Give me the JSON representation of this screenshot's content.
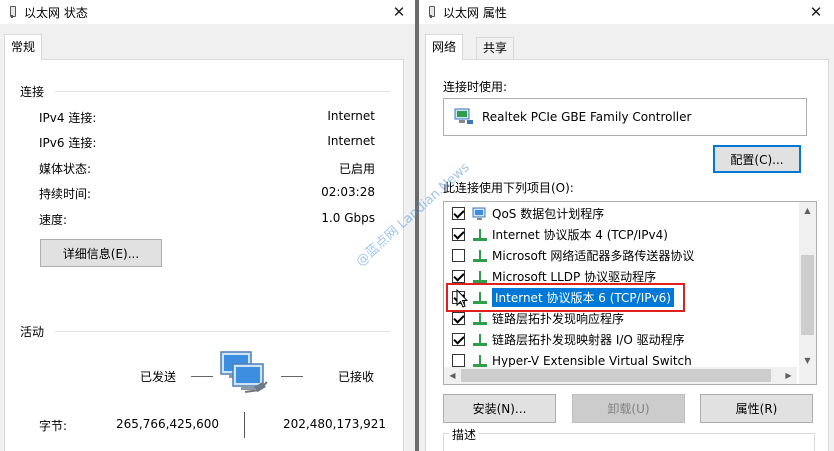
{
  "left_window": {
    "title": "以太网 状态",
    "tab": "常规",
    "connection": {
      "heading": "连接",
      "rows": [
        {
          "label": "IPv4 连接:",
          "value": "Internet"
        },
        {
          "label": "IPv6 连接:",
          "value": "Internet"
        },
        {
          "label": "媒体状态:",
          "value": "已启用"
        },
        {
          "label": "持续时间:",
          "value": "02:03:28"
        },
        {
          "label": "速度:",
          "value": "1.0 Gbps"
        }
      ],
      "details_button": "详细信息(E)..."
    },
    "activity": {
      "heading": "活动",
      "sent_label": "已发送",
      "received_label": "已接收",
      "bytes_label": "字节:",
      "bytes_sent": "265,766,425,600",
      "bytes_received": "202,480,173,921"
    }
  },
  "right_window": {
    "title": "以太网 属性",
    "tabs": [
      "网络",
      "共享"
    ],
    "connect_using_label": "连接时使用:",
    "adapter_name": "Realtek PCIe GBE Family Controller",
    "configure_button": "配置(C)...",
    "items_label": "此连接使用下列项目(O):",
    "items": [
      {
        "label": "QoS 数据包计划程序",
        "checked": true,
        "icon": "qos-network-icon"
      },
      {
        "label": "Internet 协议版本 4 (TCP/IPv4)",
        "checked": true,
        "icon": "protocol-icon"
      },
      {
        "label": "Microsoft 网络适配器多路传送器协议",
        "checked": false,
        "icon": "protocol-icon"
      },
      {
        "label": "Microsoft LLDP 协议驱动程序",
        "checked": true,
        "icon": "protocol-icon"
      },
      {
        "label": "Internet 协议版本 6 (TCP/IPv6)",
        "checked": true,
        "icon": "protocol-icon",
        "selected": true
      },
      {
        "label": "链路层拓扑发现响应程序",
        "checked": true,
        "icon": "protocol-icon"
      },
      {
        "label": "链路层拓扑发现映射器 I/O 驱动程序",
        "checked": true,
        "icon": "protocol-icon"
      },
      {
        "label": "Hyper-V Extensible Virtual Switch",
        "checked": false,
        "icon": "protocol-icon"
      }
    ],
    "install_button": "安装(N)...",
    "uninstall_button": "卸载(U)",
    "properties_button": "属性(R)",
    "description_label": "描述"
  },
  "watermark": "@蓝点网 Landian.News",
  "colors": {
    "selection": "#0078d7",
    "highlight_border": "#e0201c",
    "window_bg": "#f0f0f0",
    "default_button_border": "#0078d7"
  }
}
